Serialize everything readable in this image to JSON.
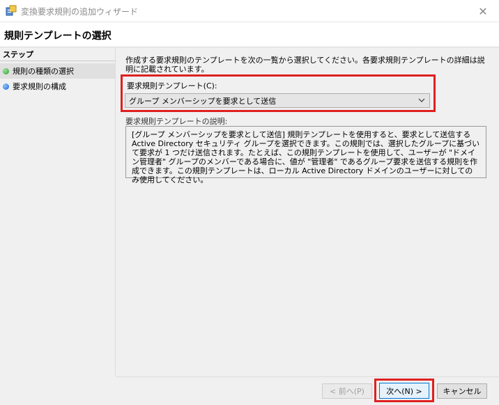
{
  "window": {
    "title": "変換要求規則の追加ウィザード",
    "close_glyph": "✕"
  },
  "header": {
    "title": "規則テンプレートの選択"
  },
  "steps": {
    "heading": "ステップ",
    "items": [
      {
        "label": "規則の種類の選択",
        "status_color": "#2a9d2a",
        "active": true
      },
      {
        "label": "要求規則の構成",
        "status_color": "#1a64d6",
        "active": false
      }
    ]
  },
  "main": {
    "intro": "作成する要求規則のテンプレートを次の一覧から選択してください。各要求規則テンプレートの詳細は説明に記載されています。",
    "template_label": "要求規則テンプレート(C):",
    "template_selected": "グループ メンバーシップを要求として送信",
    "description_label": "要求規則テンプレートの説明:",
    "description": "[グループ メンバーシップを要求として送信] 規則テンプレートを使用すると、要求として送信する Active Directory セキュリティ グループを選択できます。この規則では、選択したグループに基づいて要求が 1 つだけ送信されます。たとえば、この規則テンプレートを使用して、ユーザーが \"ドメイン管理者\" グループのメンバーである場合に、値が \"管理者\" であるグループ要求を送信する規則を作成できます。この規則テンプレートは、ローカル Active Directory ドメインのユーザーに対してのみ使用してください。"
  },
  "footer": {
    "back_label": "< 前へ(P)",
    "next_label": "次へ(N) >",
    "cancel_label": "キャンセル"
  },
  "colors": {
    "highlight": "#e02020",
    "focus_border": "#0078d7"
  }
}
